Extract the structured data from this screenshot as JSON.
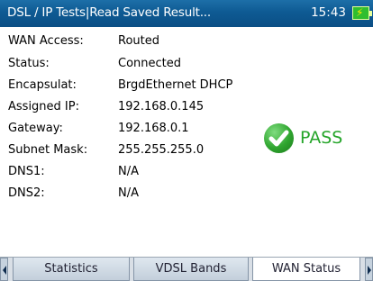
{
  "header": {
    "title": "DSL / IP Tests|Read Saved Result...",
    "time": "15:43"
  },
  "fields": [
    {
      "label": "WAN Access:",
      "value": "Routed"
    },
    {
      "label": "Status:",
      "value": "Connected"
    },
    {
      "label": "Encapsulat:",
      "value": "BrgdEthernet DHCP"
    },
    {
      "label": "Assigned IP:",
      "value": "192.168.0.145"
    },
    {
      "label": "Gateway:",
      "value": "192.168.0.1"
    },
    {
      "label": "Subnet Mask:",
      "value": "255.255.255.0"
    },
    {
      "label": "DNS1:",
      "value": "N/A"
    },
    {
      "label": "DNS2:",
      "value": "N/A"
    }
  ],
  "result": {
    "label": "PASS",
    "color": "#25a52a"
  },
  "tabs": [
    {
      "label": "Statistics",
      "active": false
    },
    {
      "label": "VDSL Bands",
      "active": false
    },
    {
      "label": "WAN Status",
      "active": true
    }
  ],
  "icons": {
    "battery": "battery-charging-icon",
    "pass": "checkmark-icon",
    "prev": "arrow-left-icon",
    "next": "arrow-right-icon"
  }
}
